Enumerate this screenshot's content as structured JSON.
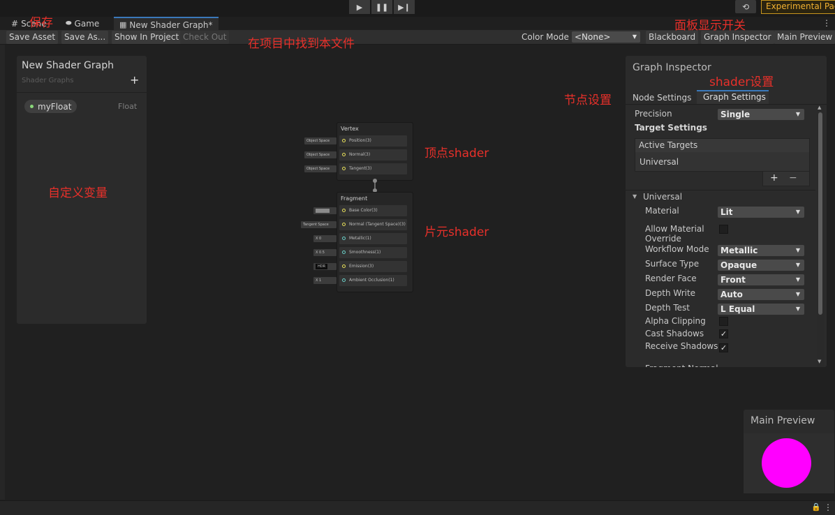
{
  "topbar": {
    "play_icon": "play-icon",
    "pause_icon": "pause-icon",
    "step_icon": "step-icon",
    "history_icon": "history-icon",
    "experimental_label": "Experimental Pac"
  },
  "tabs": {
    "scene": "Scene",
    "game": "Game",
    "shader": "New Shader Graph*",
    "more_icon": "more-vert-icon"
  },
  "toolbar": {
    "save_asset": "Save Asset",
    "save_as": "Save As...",
    "show_in_project": "Show In Project",
    "check_out": "Check Out",
    "color_mode_label": "Color Mode",
    "color_mode_value": "<None>",
    "blackboard": "Blackboard",
    "graph_inspector": "Graph Inspector",
    "main_preview": "Main Preview"
  },
  "annotations": {
    "save": "保存",
    "find_in_project": "在项目中找到本文件",
    "panel_toggle": "面板显示开关",
    "shader_settings": "shader设置",
    "node_settings": "节点设置",
    "vertex_shader": "顶点shader",
    "fragment_shader": "片元shader",
    "custom_variables": "自定义变量"
  },
  "blackboard": {
    "title": "New Shader Graph",
    "subtitle": "Shader Graphs",
    "add_icon": "plus-icon",
    "property_name": "myFloat",
    "property_type": "Float"
  },
  "vertex_node": {
    "title": "Vertex",
    "slots": [
      {
        "label": "Position(3)",
        "pin": "Object Space"
      },
      {
        "label": "Normal(3)",
        "pin": "Object Space"
      },
      {
        "label": "Tangent(3)",
        "pin": "Object Space"
      }
    ]
  },
  "fragment_node": {
    "title": "Fragment",
    "slots": [
      {
        "label": "Base Color(3)",
        "pin": ""
      },
      {
        "label": "Normal (Tangent Space)(3)",
        "pin": "Tangent Space"
      },
      {
        "label": "Metallic(1)",
        "pin": "X  0"
      },
      {
        "label": "Smoothness(1)",
        "pin": "X  0.5"
      },
      {
        "label": "Emission(3)",
        "pin": "HDR"
      },
      {
        "label": "Ambient Occlusion(1)",
        "pin": "X  1"
      }
    ]
  },
  "inspector": {
    "title": "Graph Inspector",
    "tab_node": "Node Settings",
    "tab_graph": "Graph Settings",
    "precision_label": "Precision",
    "precision_value": "Single",
    "target_settings": "Target Settings",
    "active_targets": "Active Targets",
    "target_item": "Universal",
    "section_universal": "Universal",
    "rows": [
      {
        "label": "Material",
        "value": "Lit",
        "kind": "dropdown"
      },
      {
        "label": "Allow Material Override",
        "value": "",
        "kind": "checkbox"
      },
      {
        "label": "Workflow Mode",
        "value": "Metallic",
        "kind": "dropdown"
      },
      {
        "label": "Surface Type",
        "value": "Opaque",
        "kind": "dropdown"
      },
      {
        "label": "Render Face",
        "value": "Front",
        "kind": "dropdown"
      },
      {
        "label": "Depth Write",
        "value": "Auto",
        "kind": "dropdown"
      },
      {
        "label": "Depth Test",
        "value": "L Equal",
        "kind": "dropdown"
      },
      {
        "label": "Alpha Clipping",
        "value": "",
        "kind": "checkbox"
      },
      {
        "label": "Cast Shadows",
        "value": "✓",
        "kind": "checkbox"
      },
      {
        "label": "Receive Shadows",
        "value": "✓",
        "kind": "checkbox"
      }
    ],
    "cut_label": "Fragment Normal"
  },
  "preview": {
    "title": "Main Preview",
    "sphere_color": "#ff00ff"
  },
  "statusbar": {
    "lock_icon": "lock-icon",
    "menu_icon": "more-vert-icon"
  }
}
